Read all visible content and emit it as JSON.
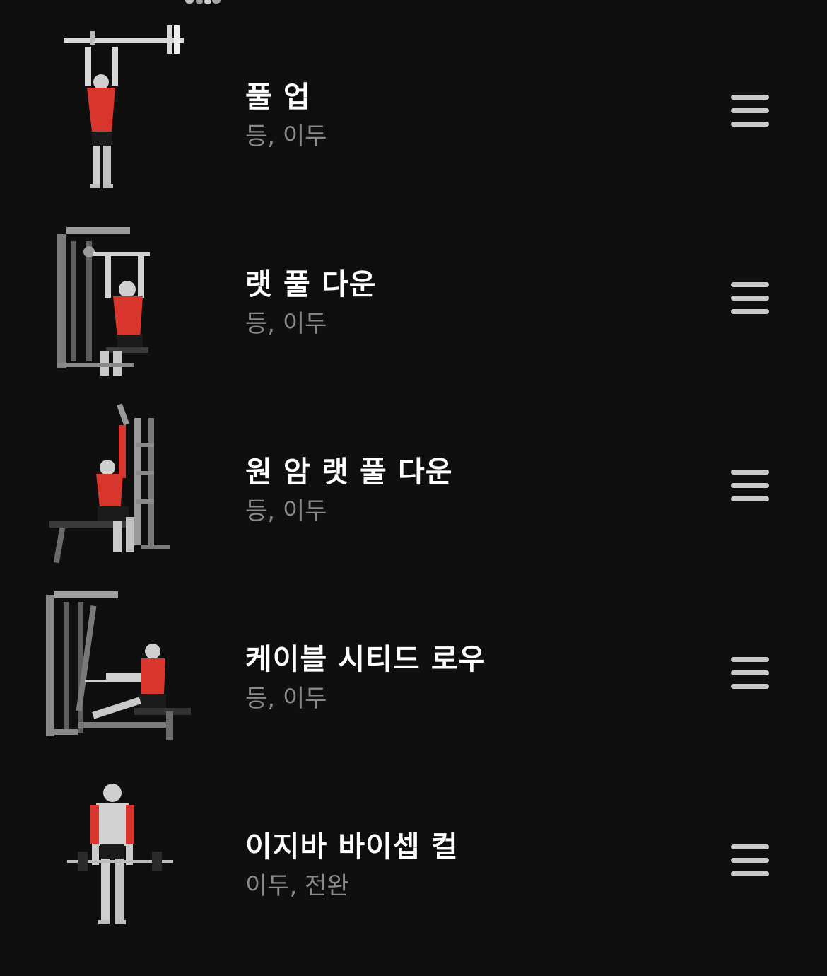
{
  "colors": {
    "background": "#0f0f10",
    "title": "#ffffff",
    "subtitle": "#8a8a8a",
    "handle": "#c9c9c9",
    "muscle_highlight": "#d8362c"
  },
  "exercises": [
    {
      "name": "풀 업",
      "muscles": "등, 이두",
      "illustration": "pull-up-illustration"
    },
    {
      "name": "랫 풀 다운",
      "muscles": "등, 이두",
      "illustration": "lat-pulldown-illustration"
    },
    {
      "name": "원 암 랫 풀 다운",
      "muscles": "등, 이두",
      "illustration": "one-arm-lat-pulldown-illustration"
    },
    {
      "name": "케이블 시티드 로우",
      "muscles": "등, 이두",
      "illustration": "cable-seated-row-illustration"
    },
    {
      "name": "이지바 바이셉 컬",
      "muscles": "이두, 전완",
      "illustration": "ez-bar-bicep-curl-illustration"
    }
  ],
  "icons": {
    "drag_handle": "drag-handle-icon"
  }
}
